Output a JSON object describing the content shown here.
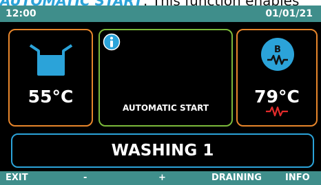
{
  "caption": {
    "accent": "AUTOMATIC START",
    "rest": ": This function enables"
  },
  "status_bar": {
    "time": "12:00",
    "date": "01/01/21"
  },
  "tank_panel": {
    "icon": "wash-tank-icon",
    "temperature": "55°C"
  },
  "center_panel": {
    "icon": "info-icon",
    "label": "AUTOMATIC START"
  },
  "boiler_panel": {
    "badge": "B",
    "icon": "heater-icon",
    "temperature": "79°C",
    "heater_status_icon": "heater-active-icon"
  },
  "program": {
    "name": "WASHING 1"
  },
  "softkeys": {
    "exit": "EXIT",
    "minus": "-",
    "plus": "+",
    "draining": "DRAINING",
    "info": "INFO"
  },
  "colors": {
    "bar": "#3f8e8b",
    "accent_blue": "#2ba3d9",
    "panel_orange": "#e8862b",
    "panel_green": "#7cba3b",
    "heater_red": "#e32b2b"
  }
}
